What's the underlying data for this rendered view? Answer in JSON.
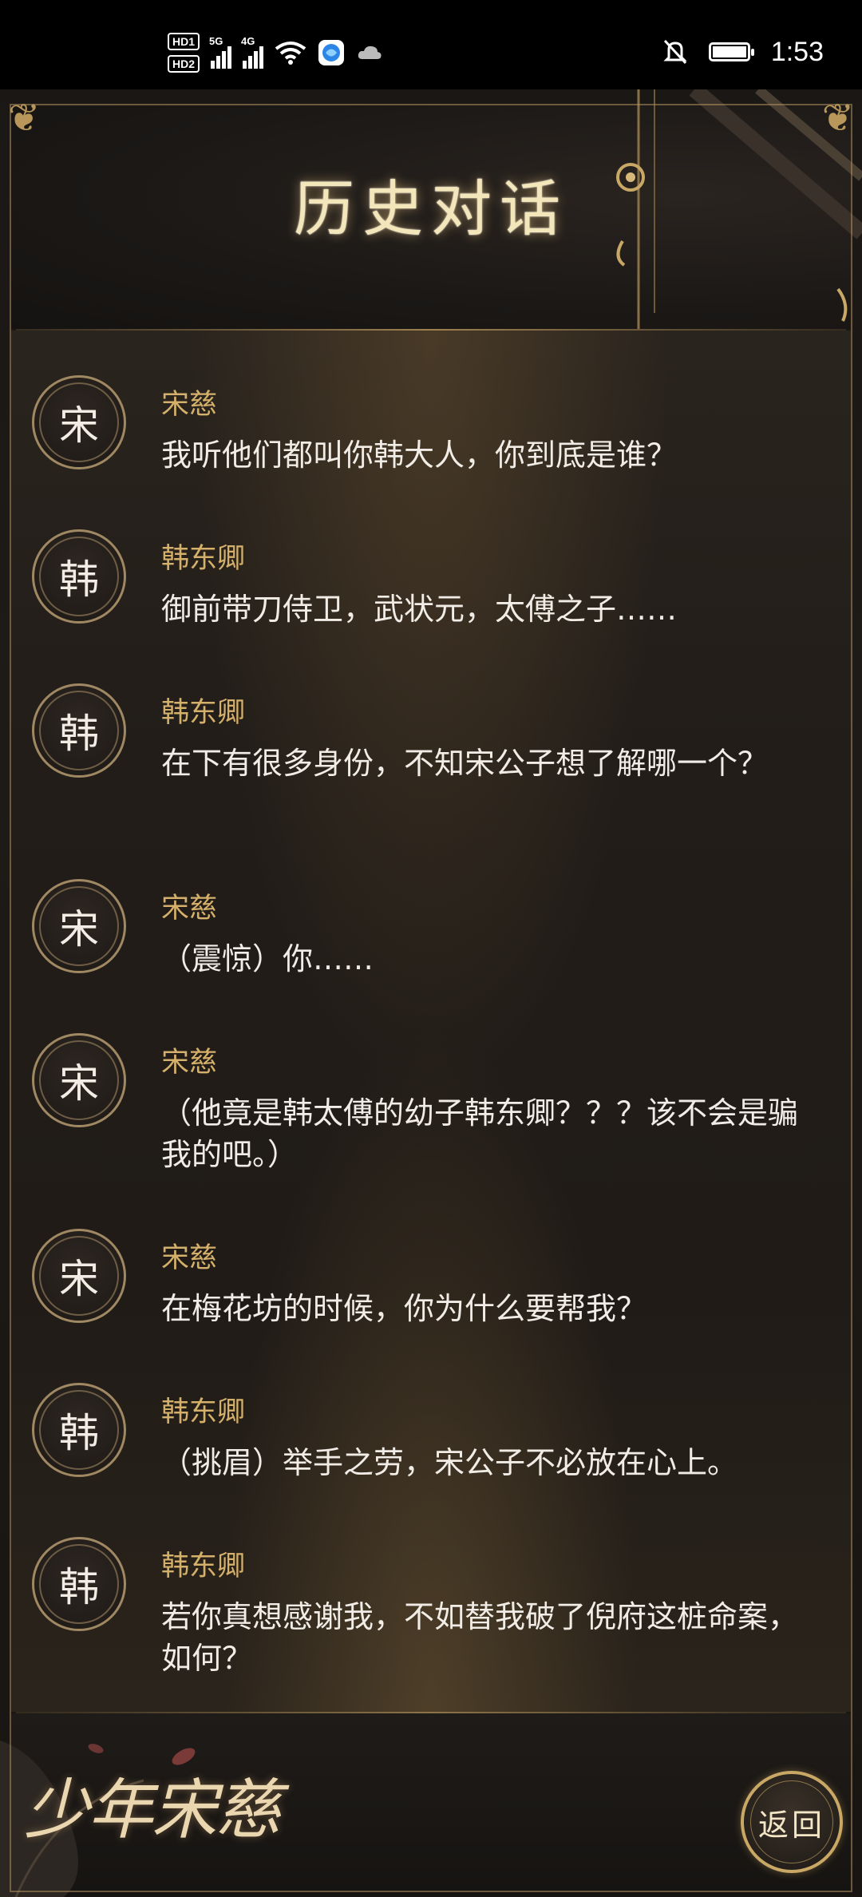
{
  "status_bar": {
    "hd1": "HD1",
    "hd2": "HD2",
    "net1": "5G",
    "net2": "4G",
    "time": "1:53",
    "icons": [
      "hd-icon",
      "signal-icon",
      "wifi-icon",
      "browser-icon",
      "cloud-icon",
      "bell-off-icon",
      "battery-icon"
    ]
  },
  "header": {
    "title": "历史对话"
  },
  "dialogue": [
    {
      "avatar": "宋",
      "speaker": "宋慈",
      "text": "我听他们都叫你韩大人，你到底是谁？"
    },
    {
      "avatar": "韩",
      "speaker": "韩东卿",
      "text": "御前带刀侍卫，武状元，太傅之子……"
    },
    {
      "avatar": "韩",
      "speaker": "韩东卿",
      "text": "在下有很多身份，不知宋公子想了解哪一个？"
    },
    {
      "avatar": "宋",
      "speaker": "宋慈",
      "text": "（震惊）你……"
    },
    {
      "avatar": "宋",
      "speaker": "宋慈",
      "text": "（他竟是韩太傅的幼子韩东卿？？？该不会是骗我的吧。）"
    },
    {
      "avatar": "宋",
      "speaker": "宋慈",
      "text": "在梅花坊的时候，你为什么要帮我？"
    },
    {
      "avatar": "韩",
      "speaker": "韩东卿",
      "text": "（挑眉）举手之劳，宋公子不必放在心上。"
    },
    {
      "avatar": "韩",
      "speaker": "韩东卿",
      "text": "若你真想感谢我，不如替我破了倪府这桩命案，如何？"
    }
  ],
  "footer": {
    "logo": "少年宋慈",
    "back_label": "返回"
  },
  "colors": {
    "title": "#f4e6bb",
    "speaker": "#d4b06a",
    "text": "#f1ede6",
    "gold_border": "#b9975a"
  }
}
